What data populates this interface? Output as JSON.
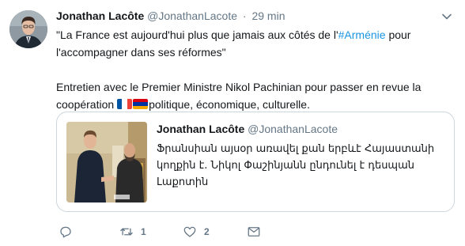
{
  "tweet": {
    "author_name": "Jonathan Lacôte",
    "author_handle": "@JonathanLacote",
    "separator": "·",
    "time": "29 min",
    "text_line1_before": "\"La France est aujourd'hui plus que jamais aux côtés de l'",
    "hashtag": "#Arménie",
    "text_line1_after": " pour",
    "text_line2": "l'accompagner dans ses réformes\"",
    "text_line3": "Entretien avec le Premier Ministre Nikol Pachinian pour passer en revue la",
    "text_line4_before": "coopération ",
    "text_line4_after": "politique, économique, culturelle.",
    "flag_fr_icon": "france-flag-icon",
    "flag_am_icon": "armenia-flag-icon"
  },
  "quoted_tweet": {
    "author_name": "Jonathan Lacôte",
    "author_handle": "@JonathanLacote",
    "text": "Ֆրանսիան այսօր առավել քան երբևէ Հայաստանի կողքին է. Նիկոլ Փաշինյանն ընդունել է դեսպան Լաքոտին",
    "image_icon": "meeting-photo-image"
  },
  "actions": {
    "reply_icon": "reply-icon",
    "retweet_icon": "retweet-icon",
    "retweet_count": "1",
    "like_icon": "heart-icon",
    "like_count": "2",
    "dm_icon": "envelope-icon"
  },
  "colors": {
    "text": "#14171a",
    "secondary": "#657786",
    "link": "#1b95e0",
    "border": "#ccd6dd"
  }
}
